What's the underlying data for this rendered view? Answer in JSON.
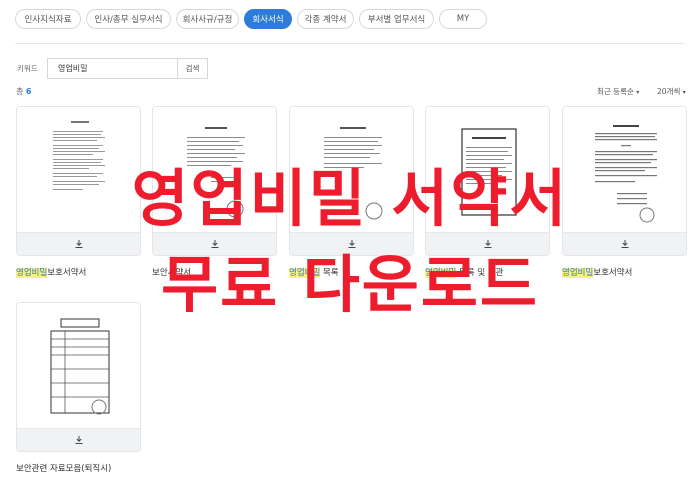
{
  "tabs": [
    {
      "label": "인사지식자료",
      "active": false
    },
    {
      "label": "인사/총무 실무서식",
      "active": false
    },
    {
      "label": "회사사규/규정",
      "active": false
    },
    {
      "label": "회사서식",
      "active": true
    },
    {
      "label": "각종 계약서",
      "active": false
    },
    {
      "label": "부서별 업무서식",
      "active": false
    },
    {
      "label": "MY",
      "active": false
    }
  ],
  "search": {
    "label": "키워드",
    "value": "영업비밀",
    "button": "검색"
  },
  "results": {
    "total_label": "총",
    "total_count": "6",
    "sort_label": "최근 등록순",
    "per_page_label": "20개씩"
  },
  "cards": [
    {
      "title_highlight": "영업비밀",
      "title_rest": "보호서약서"
    },
    {
      "title_highlight": "",
      "title_rest": "보안서약서"
    },
    {
      "title_highlight": "영업비밀",
      "title_rest": " 목록"
    },
    {
      "title_highlight": "영업비밀",
      "title_rest": " 목록 및 보관"
    },
    {
      "title_highlight": "영업비밀",
      "title_rest": "보호서약서"
    },
    {
      "title_highlight": "",
      "title_rest": "보안관련 자료모음(퇴직시)"
    }
  ],
  "overlay": {
    "line1": "영업비밀 서약서",
    "line2": "무료 다운로드"
  },
  "colors": {
    "accent": "#2e7bd9",
    "overlay_red": "#ee1d2d",
    "highlight": "#fbf07a"
  }
}
